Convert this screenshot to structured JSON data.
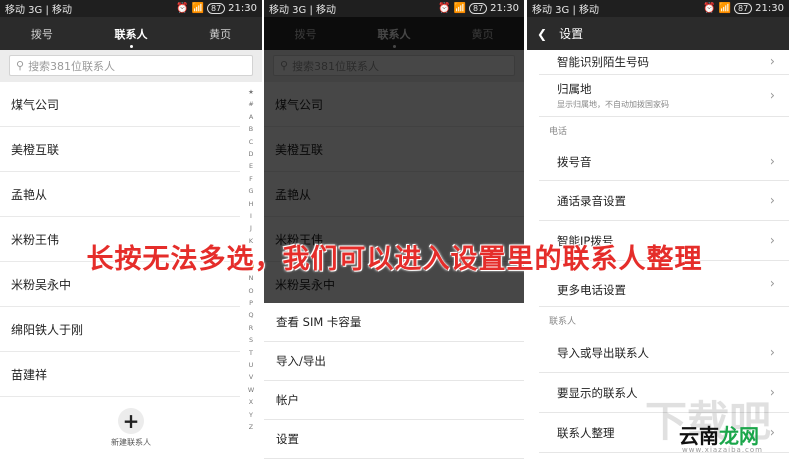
{
  "status": {
    "carrier": "移动 3G | 移动",
    "battery": "87",
    "time": "21:30"
  },
  "tabs": [
    {
      "label": "拨号"
    },
    {
      "label": "联系人"
    },
    {
      "label": "黄页"
    }
  ],
  "search": {
    "placeholder": "搜索381位联系人"
  },
  "contacts": [
    {
      "name": "煤气公司"
    },
    {
      "name": "美橙互联"
    },
    {
      "name": "孟艳从"
    },
    {
      "name": "米粉王伟"
    },
    {
      "name": "米粉吴永中"
    },
    {
      "name": "绵阳铁人于刚"
    },
    {
      "name": "苗建祥"
    }
  ],
  "alphabet": [
    "★",
    "#",
    "A",
    "B",
    "C",
    "D",
    "E",
    "F",
    "G",
    "H",
    "I",
    "J",
    "K",
    "L",
    "M",
    "N",
    "O",
    "P",
    "Q",
    "R",
    "S",
    "T",
    "U",
    "V",
    "W",
    "X",
    "Y",
    "Z"
  ],
  "alphabet_highlight": "M",
  "new_contact_label": "新建联系人",
  "menu": [
    {
      "label": "查看 SIM 卡容量"
    },
    {
      "label": "导入/导出"
    },
    {
      "label": "帐户"
    },
    {
      "label": "设置"
    }
  ],
  "settings": {
    "title": "设置",
    "rows": [
      {
        "type": "item",
        "title": "智能识别陌生号码",
        "subtitle": ""
      },
      {
        "type": "item",
        "title": "归属地",
        "subtitle": "显示归属地，不自动加拨国家码"
      },
      {
        "type": "section",
        "title": "电话"
      },
      {
        "type": "item",
        "title": "拨号音",
        "subtitle": ""
      },
      {
        "type": "item",
        "title": "通话录音设置",
        "subtitle": ""
      },
      {
        "type": "item",
        "title": "智能IP拨号",
        "subtitle": ""
      },
      {
        "type": "item",
        "title": "更多电话设置",
        "subtitle": ""
      },
      {
        "type": "section",
        "title": "联系人"
      },
      {
        "type": "item",
        "title": "导入或导出联系人",
        "subtitle": ""
      },
      {
        "type": "item",
        "title": "要显示的联系人",
        "subtitle": ""
      },
      {
        "type": "item",
        "title": "联系人整理",
        "subtitle": ""
      }
    ]
  },
  "overlay_caption": "长按无法多选，我们可以进入设置里的联系人整理",
  "watermark": {
    "logo": "下载吧",
    "brand_a": "云南",
    "brand_b": "龙网",
    "url": "www.xiazaiba.com"
  },
  "colors": {
    "caption": "#e52d2a",
    "highlight": "#e38a00",
    "header": "#2b2b2b"
  }
}
